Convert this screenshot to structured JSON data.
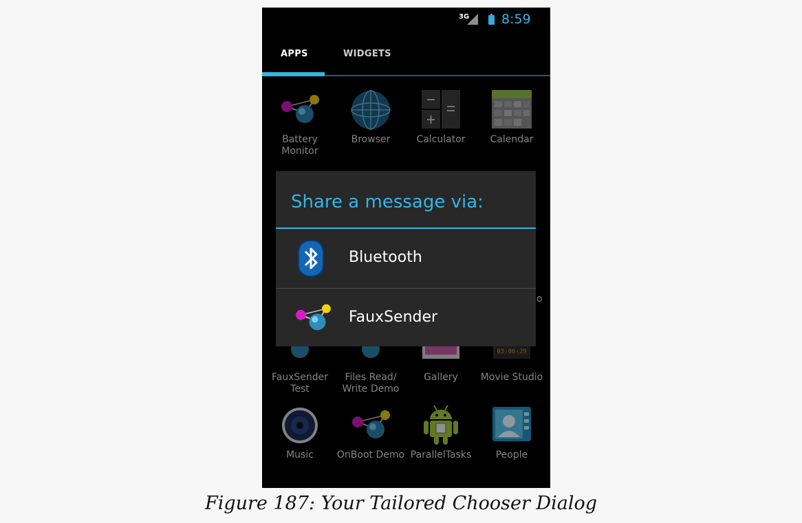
{
  "status_bar": {
    "network": "3G",
    "time": "8:59"
  },
  "tabs": [
    {
      "label": "APPS"
    },
    {
      "label": "WIDGETS"
    }
  ],
  "apps": [
    {
      "label": "Battery\nMonitor",
      "icon": "molecule-icon"
    },
    {
      "label": "Browser",
      "icon": "globe-icon"
    },
    {
      "label": "Calculator",
      "icon": "calculator-icon"
    },
    {
      "label": "Calendar",
      "icon": "calendar-icon"
    },
    {
      "label": "FauxSender\nTest",
      "icon": "molecule-icon"
    },
    {
      "label": "Files Read/\nWrite Demo",
      "icon": "molecule-icon"
    },
    {
      "label": "Gallery",
      "icon": "gallery-icon"
    },
    {
      "label": "Movie Studio",
      "icon": "movie-studio-icon"
    },
    {
      "label": "Music",
      "icon": "music-speaker-icon"
    },
    {
      "label": "OnBoot Demo",
      "icon": "molecule-icon"
    },
    {
      "label": "ParallelTasks",
      "icon": "android-icon"
    },
    {
      "label": "People",
      "icon": "people-icon"
    }
  ],
  "partial_label": "o",
  "dialog": {
    "title": "Share a message via:",
    "items": [
      {
        "label": "Bluetooth",
        "icon": "bluetooth-icon"
      },
      {
        "label": "FauxSender",
        "icon": "molecule-icon"
      }
    ]
  },
  "caption": "Figure 187: Your Tailored Chooser Dialog",
  "colors": {
    "accent": "#33b5e5",
    "dialog_bg": "#282828"
  }
}
